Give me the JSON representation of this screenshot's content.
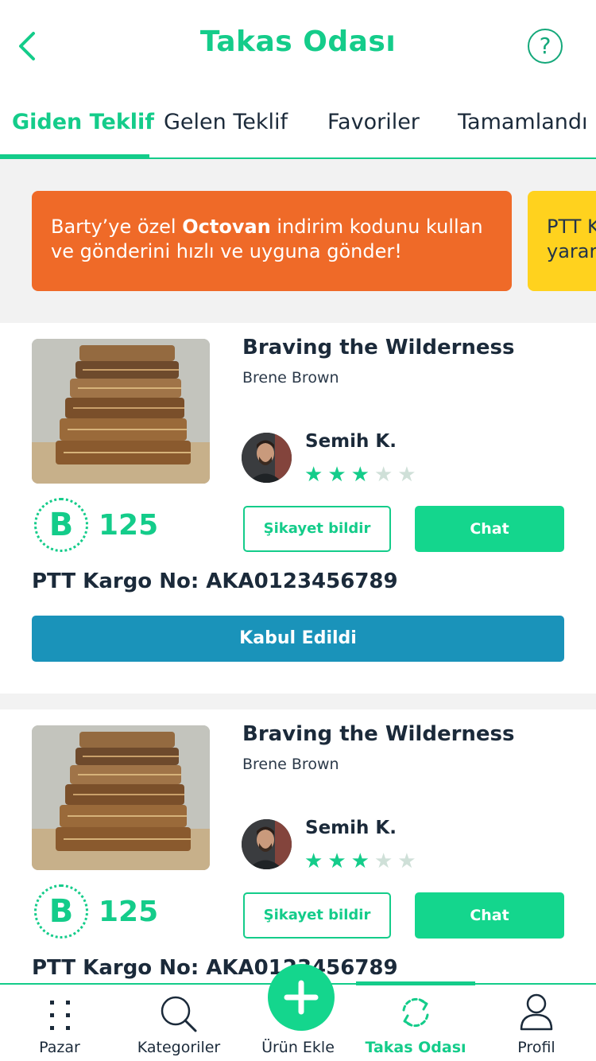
{
  "header": {
    "title": "Takas Odası",
    "help_symbol": "?"
  },
  "tabs": [
    {
      "label": "Giden Teklif",
      "active": true
    },
    {
      "label": "Gelen Teklif",
      "active": false
    },
    {
      "label": "Favoriler",
      "active": false
    },
    {
      "label": "Tamamlandı",
      "active": false
    }
  ],
  "promos": [
    {
      "text_before": "Barty’ye özel ",
      "highlight": "Octovan",
      "text_after": " indirim kodunu kullan ve gönderini hızlı ve uyguna gönder!",
      "color": "#ef6a28"
    },
    {
      "line1": "PTT K",
      "line2": "yarar",
      "color": "#ffd21e"
    }
  ],
  "offers": [
    {
      "title": "Braving the Wilderness",
      "author": "Brene Brown",
      "user_name": "Semih K.",
      "rating": 3,
      "rating_max": 5,
      "points_symbol": "B",
      "points": "125",
      "complain_label": "Şikayet bildir",
      "chat_label": "Chat",
      "cargo": "PTT Kargo No: AKA0123456789",
      "status_label": "Kabul Edildi"
    },
    {
      "title": "Braving the Wilderness",
      "author": "Brene Brown",
      "user_name": "Semih K.",
      "rating": 3,
      "rating_max": 5,
      "points_symbol": "B",
      "points": "125",
      "complain_label": "Şikayet bildir",
      "chat_label": "Chat",
      "cargo": "PTT Kargo No: AKA0123456789"
    }
  ],
  "bottom_nav": [
    {
      "label": "Pazar",
      "icon": "grid-dots-icon",
      "active": false
    },
    {
      "label": "Kategoriler",
      "icon": "search-icon",
      "active": false
    },
    {
      "label": "Ürün Ekle",
      "icon": "plus-icon",
      "active": false
    },
    {
      "label": "Takas Odası",
      "icon": "swap-cycle-icon",
      "active": true
    },
    {
      "label": "Profil",
      "icon": "user-icon",
      "active": false
    }
  ],
  "fab": {
    "symbol": "+"
  },
  "colors": {
    "accent": "#14cc8a",
    "accent_button": "#14d68d",
    "promo_orange": "#ef6a28",
    "promo_yellow": "#ffd21e",
    "accepted_blue": "#1a93ba",
    "text_dark": "#1b2a3a"
  }
}
